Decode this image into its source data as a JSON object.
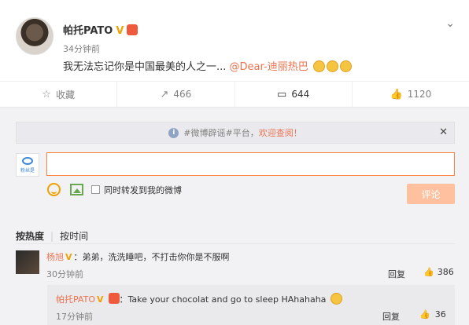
{
  "post": {
    "author": "帕托PATO",
    "time": "34分钟前",
    "text": "我无法忘记你是中国最美的人之一...",
    "mention": "@Dear-迪丽热巴"
  },
  "actions": {
    "favorite": "收藏",
    "repost": "466",
    "comment": "644",
    "like": "1120"
  },
  "notice": {
    "tag": "#微博辟谣#平台，",
    "highlight": "欢迎查阅！"
  },
  "composer": {
    "avatar_label": "粉丝是",
    "share_label": "同时转发到我的微博",
    "submit_label": "评论"
  },
  "sort": {
    "hot": "按热度",
    "time": "按时间"
  },
  "comment": {
    "author": "杨旭",
    "text": "：弟弟，洗洗睡吧，不打击你你是不服啊",
    "time": "30分钟前",
    "reply_label": "回复",
    "likes": "386"
  },
  "subreply": {
    "author": "帕托PATO",
    "text": "：Take your chocolat and go to sleep HAhahaha",
    "time": "17分钟前",
    "reply_label": "回复",
    "likes": "36"
  },
  "colors": {
    "accent": "#eb7350",
    "vip": "#f0a000",
    "submit_disabled": "#ffc09f"
  }
}
